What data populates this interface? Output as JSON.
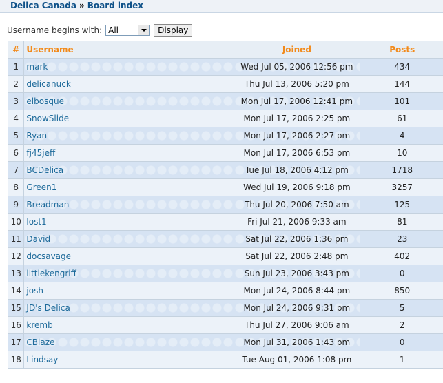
{
  "breadcrumb": {
    "site": "Delica Canada",
    "separator": "»",
    "page": "Board index"
  },
  "filter": {
    "label": "Username begins with:",
    "selected": "All",
    "button": "Display"
  },
  "table": {
    "headers": {
      "num": "#",
      "username": "Username",
      "joined": "Joined",
      "posts": "Posts"
    },
    "rows": [
      {
        "num": "1",
        "username": "mark",
        "joined": "Wed Jul 05, 2006 12:56 pm",
        "posts": "434"
      },
      {
        "num": "2",
        "username": "delicanuck",
        "joined": "Thu Jul 13, 2006 5:20 pm",
        "posts": "144"
      },
      {
        "num": "3",
        "username": "elbosque",
        "joined": "Mon Jul 17, 2006 12:41 pm",
        "posts": "101"
      },
      {
        "num": "4",
        "username": "SnowSlide",
        "joined": "Mon Jul 17, 2006 2:25 pm",
        "posts": "61"
      },
      {
        "num": "5",
        "username": "Ryan",
        "joined": "Mon Jul 17, 2006 2:27 pm",
        "posts": "4"
      },
      {
        "num": "6",
        "username": "fj45jeff",
        "joined": "Mon Jul 17, 2006 6:53 pm",
        "posts": "10"
      },
      {
        "num": "7",
        "username": "BCDelica",
        "joined": "Tue Jul 18, 2006 4:12 pm",
        "posts": "1718"
      },
      {
        "num": "8",
        "username": "Green1",
        "joined": "Wed Jul 19, 2006 9:18 pm",
        "posts": "3257"
      },
      {
        "num": "9",
        "username": "Breadman",
        "joined": "Thu Jul 20, 2006 7:50 am",
        "posts": "125"
      },
      {
        "num": "10",
        "username": "lost1",
        "joined": "Fri Jul 21, 2006 9:33 am",
        "posts": "81"
      },
      {
        "num": "11",
        "username": "David",
        "joined": "Sat Jul 22, 2006 1:36 pm",
        "posts": "23"
      },
      {
        "num": "12",
        "username": "docsavage",
        "joined": "Sat Jul 22, 2006 2:48 pm",
        "posts": "402"
      },
      {
        "num": "13",
        "username": "littlekengriff",
        "joined": "Sun Jul 23, 2006 3:43 pm",
        "posts": "0"
      },
      {
        "num": "14",
        "username": "josh",
        "joined": "Mon Jul 24, 2006 8:44 pm",
        "posts": "850"
      },
      {
        "num": "15",
        "username": "JD's Delica",
        "joined": "Mon Jul 24, 2006 9:31 pm",
        "posts": "5"
      },
      {
        "num": "16",
        "username": "kremb",
        "joined": "Thu Jul 27, 2006 9:06 am",
        "posts": "2"
      },
      {
        "num": "17",
        "username": "CBlaze",
        "joined": "Mon Jul 31, 2006 1:43 pm",
        "posts": "0"
      },
      {
        "num": "18",
        "username": "Lindsay",
        "joined": "Tue Aug 01, 2006 1:08 pm",
        "posts": "1"
      }
    ]
  },
  "colors": {
    "header_text": "#f28a1a",
    "link": "#1d6a9a",
    "row_odd": "#d6e3f3",
    "row_even": "#ecf2f9"
  }
}
